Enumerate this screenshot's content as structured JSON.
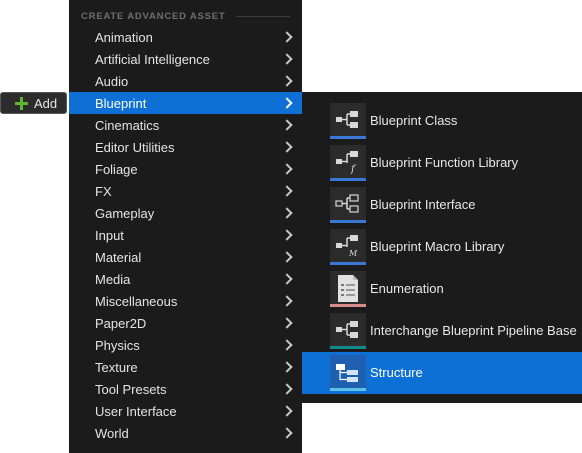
{
  "add_button": {
    "label": "Add"
  },
  "menu": {
    "section_header": "CREATE ADVANCED ASSET",
    "items": [
      {
        "label": "Animation"
      },
      {
        "label": "Artificial Intelligence"
      },
      {
        "label": "Audio"
      },
      {
        "label": "Blueprint"
      },
      {
        "label": "Cinematics"
      },
      {
        "label": "Editor Utilities"
      },
      {
        "label": "Foliage"
      },
      {
        "label": "FX"
      },
      {
        "label": "Gameplay"
      },
      {
        "label": "Input"
      },
      {
        "label": "Material"
      },
      {
        "label": "Media"
      },
      {
        "label": "Miscellaneous"
      },
      {
        "label": "Paper2D"
      },
      {
        "label": "Physics"
      },
      {
        "label": "Texture"
      },
      {
        "label": "Tool Presets"
      },
      {
        "label": "User Interface"
      },
      {
        "label": "World"
      }
    ],
    "active_item": "Blueprint"
  },
  "submenu": {
    "items": [
      {
        "label": "Blueprint Class",
        "icon": "blueprint-class-icon"
      },
      {
        "label": "Blueprint Function Library",
        "icon": "blueprint-function-library-icon"
      },
      {
        "label": "Blueprint Interface",
        "icon": "blueprint-interface-icon"
      },
      {
        "label": "Blueprint Macro Library",
        "icon": "blueprint-macro-library-icon"
      },
      {
        "label": "Enumeration",
        "icon": "enumeration-icon"
      },
      {
        "label": "Interchange Blueprint Pipeline Base",
        "icon": "interchange-pipeline-icon"
      },
      {
        "label": "Structure",
        "icon": "structure-icon"
      }
    ],
    "active_item": "Structure"
  },
  "colors": {
    "menu_bg": "#1b1b1b",
    "highlight": "#0e70d5",
    "add_plus": "#5fb82e",
    "blueprint_bar": "#3a78d8",
    "enum_bar": "#d98a8a"
  }
}
